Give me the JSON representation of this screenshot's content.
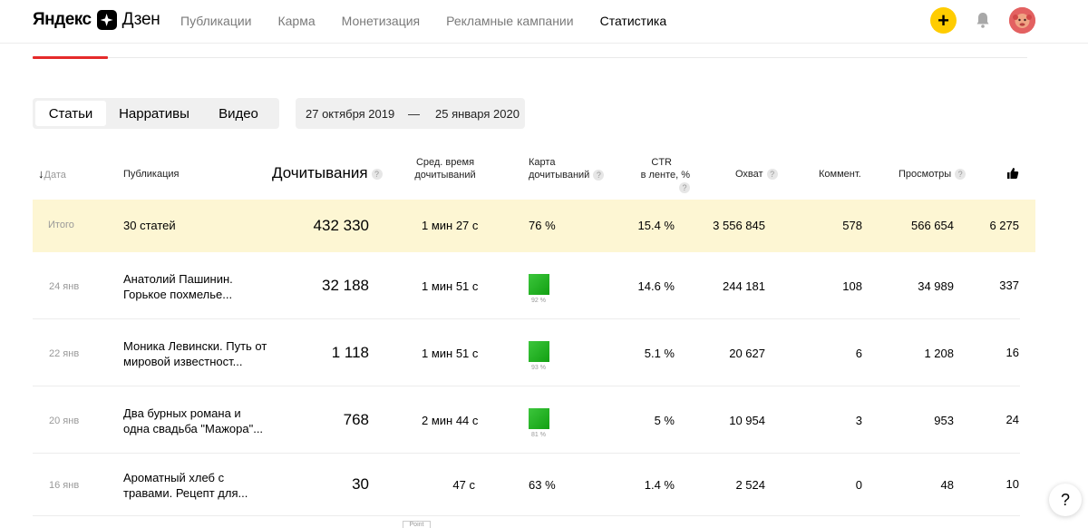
{
  "header": {
    "logo_ya": "Яндекс",
    "logo_dzen": "Дзен",
    "nav": [
      "Публикации",
      "Карма",
      "Монетизация",
      "Рекламные кампании",
      "Статистика"
    ],
    "plus_label": "+"
  },
  "tabs": [
    "Статьи",
    "Нарративы",
    "Видео"
  ],
  "date_from": "27 октября 2019",
  "date_sep": "—",
  "date_to": "25 января 2020",
  "columns": {
    "date": "Дата",
    "publication": "Публикация",
    "reads": "Дочитывания",
    "avg_time_1": "Сред. время",
    "avg_time_2": "дочитываний",
    "map_1": "Карта",
    "map_2": "дочитываний",
    "ctr_1": "CTR",
    "ctr_2": "в ленте, %",
    "reach": "Охват",
    "comments": "Коммент.",
    "views": "Просмотры",
    "q": "?"
  },
  "total": {
    "label": "Итого",
    "publication": "30 статей",
    "reads": "432 330",
    "avg_time": "1 мин 27 с",
    "map": "76 %",
    "ctr": "15.4 %",
    "reach": "3 556 845",
    "comments": "578",
    "views": "566 654",
    "likes": "6 275"
  },
  "rows": [
    {
      "date": "24 янв",
      "publication": "Анатолий Пашинин. Горькое похмелье...",
      "reads": "32 188",
      "avg_time": "1 мин 51 с",
      "map_pct": "92 %",
      "ctr": "14.6 %",
      "reach": "244 181",
      "comments": "108",
      "views": "34 989",
      "likes": "337"
    },
    {
      "date": "22 янв",
      "publication": "Моника Левински. Путь от мировой известност...",
      "reads": "1 118",
      "avg_time": "1 мин 51 с",
      "map_pct": "93 %",
      "ctr": "5.1 %",
      "reach": "20 627",
      "comments": "6",
      "views": "1 208",
      "likes": "16"
    },
    {
      "date": "20 янв",
      "publication": "Два бурных романа и одна свадьба \"Мажора\"...",
      "reads": "768",
      "avg_time": "2 мин 44 с",
      "map_pct": "81 %",
      "ctr": "5 %",
      "reach": "10 954",
      "comments": "3",
      "views": "953",
      "likes": "24"
    },
    {
      "date": "16 янв",
      "publication": "Ароматный хлеб с травами. Рецепт для...",
      "reads": "30",
      "avg_time": "47 с",
      "map": "63 %",
      "ctr": "1.4 %",
      "reach": "2 524",
      "comments": "0",
      "views": "48",
      "likes": "10"
    }
  ],
  "help_label": "?",
  "tooltip_stub": "Point",
  "colors": {
    "accent": "#ffcc00",
    "active_tab_underline": "#e52a2a",
    "total_row_bg": "#fdf6d3",
    "heat_green": "#22b022"
  }
}
